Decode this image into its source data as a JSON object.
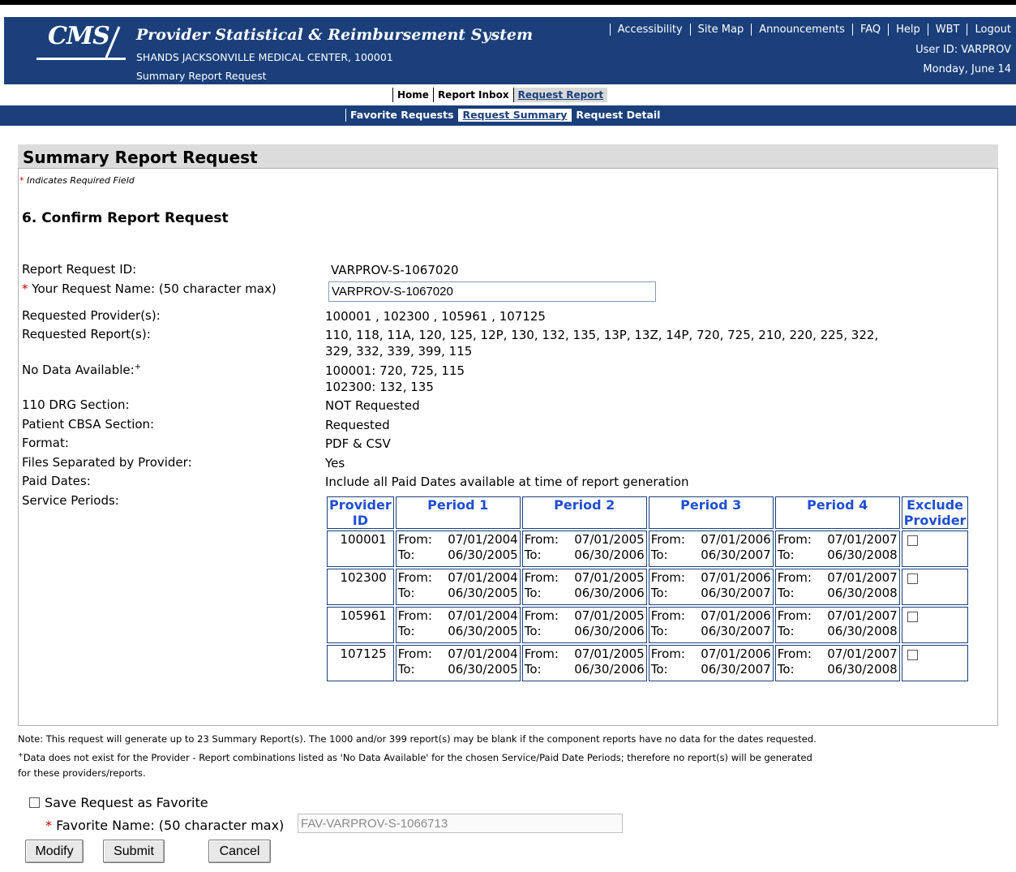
{
  "header": {
    "logo": "CMS",
    "app_title": "Provider Statistical & Reimbursement System",
    "org_name": "SHANDS JACKSONVILLE MEDICAL CENTER, 100001",
    "page_subtitle": "Summary Report Request",
    "top_links": [
      "Accessibility",
      "Site Map",
      "Announcements",
      "FAQ",
      "Help",
      "WBT",
      "Logout"
    ],
    "user_id": "User ID: VARPROV",
    "date": "Monday, June 14"
  },
  "tabs": [
    {
      "label": "Home",
      "active": false
    },
    {
      "label": "Report Inbox",
      "active": false
    },
    {
      "label": "Request Report",
      "active": true
    }
  ],
  "subnav": [
    {
      "label": "Favorite Requests",
      "active": false
    },
    {
      "label": "Request Summary",
      "active": true
    },
    {
      "label": "Request Detail",
      "active": false
    }
  ],
  "panel": {
    "title": "Summary Report Request",
    "required_note": "Indicates Required Field",
    "step_title": "6.  Confirm Report Request"
  },
  "fields": {
    "report_request_id_label": "Report Request ID:",
    "report_request_id_value": "VARPROV-S-1067020",
    "request_name_label": "Your Request Name: (50 character max)",
    "request_name_value": "VARPROV-S-1067020",
    "providers_label": "Requested Provider(s):",
    "providers_value": "100001 , 102300 , 105961 , 107125",
    "reports_label": "Requested Report(s):",
    "reports_line1": "110, 118, 11A, 120, 125, 12P, 130, 132, 135, 13P, 13Z, 14P, 720, 725, 210, 220, 225, 322,",
    "reports_line2": "329, 332, 339, 399, 115",
    "no_data_label": "No Data Available:",
    "no_data_line1": "100001: 720, 725, 115",
    "no_data_line2": "102300: 132, 135",
    "drg_label": "110 DRG Section:",
    "drg_value": "NOT Requested",
    "cbsa_label": "Patient CBSA Section:",
    "cbsa_value": "Requested",
    "format_label": "Format:",
    "format_value": "PDF & CSV",
    "separated_label": "Files Separated by Provider:",
    "separated_value": "Yes",
    "paid_dates_label": "Paid Dates:",
    "paid_dates_value": "Include all Paid Dates available at time of report generation",
    "service_periods_label": "Service Periods:"
  },
  "service_table": {
    "headers": [
      "Provider ID",
      "Period 1",
      "Period 2",
      "Period 3",
      "Period 4",
      "Exclude Provider"
    ],
    "from_label": "From:",
    "to_label": "To:",
    "rows": [
      {
        "provider": "100001",
        "periods": [
          {
            "from": "07/01/2004",
            "to": "06/30/2005"
          },
          {
            "from": "07/01/2005",
            "to": "06/30/2006"
          },
          {
            "from": "07/01/2006",
            "to": "06/30/2007"
          },
          {
            "from": "07/01/2007",
            "to": "06/30/2008"
          }
        ],
        "exclude": false
      },
      {
        "provider": "102300",
        "periods": [
          {
            "from": "07/01/2004",
            "to": "06/30/2005"
          },
          {
            "from": "07/01/2005",
            "to": "06/30/2006"
          },
          {
            "from": "07/01/2006",
            "to": "06/30/2007"
          },
          {
            "from": "07/01/2007",
            "to": "06/30/2008"
          }
        ],
        "exclude": false
      },
      {
        "provider": "105961",
        "periods": [
          {
            "from": "07/01/2004",
            "to": "06/30/2005"
          },
          {
            "from": "07/01/2005",
            "to": "06/30/2006"
          },
          {
            "from": "07/01/2006",
            "to": "06/30/2007"
          },
          {
            "from": "07/01/2007",
            "to": "06/30/2008"
          }
        ],
        "exclude": false
      },
      {
        "provider": "107125",
        "periods": [
          {
            "from": "07/01/2004",
            "to": "06/30/2005"
          },
          {
            "from": "07/01/2005",
            "to": "06/30/2006"
          },
          {
            "from": "07/01/2006",
            "to": "06/30/2007"
          },
          {
            "from": "07/01/2007",
            "to": "06/30/2008"
          }
        ],
        "exclude": false
      }
    ]
  },
  "notes": {
    "note1": "Note: This request will generate up to 23 Summary Report(s). The 1000 and/or 399 report(s) may be blank if the component reports have no data for the dates requested.",
    "note2": "Data does not exist for the Provider - Report combinations listed as 'No Data Available' for the chosen Service/Paid Date Periods; therefore no report(s) will be generated",
    "note3": "for these providers/reports."
  },
  "favorite": {
    "save_label": "Save Request as Favorite",
    "name_label": "Favorite Name: (50 character max)",
    "name_value": "FAV-VARPROV-S-1066713"
  },
  "buttons": {
    "modify": "Modify",
    "submit": "Submit",
    "cancel": "Cancel"
  },
  "colors": {
    "header_blue": "#1a3f7a",
    "link_blue": "#1f4fd0",
    "required_red": "#cc0000"
  }
}
